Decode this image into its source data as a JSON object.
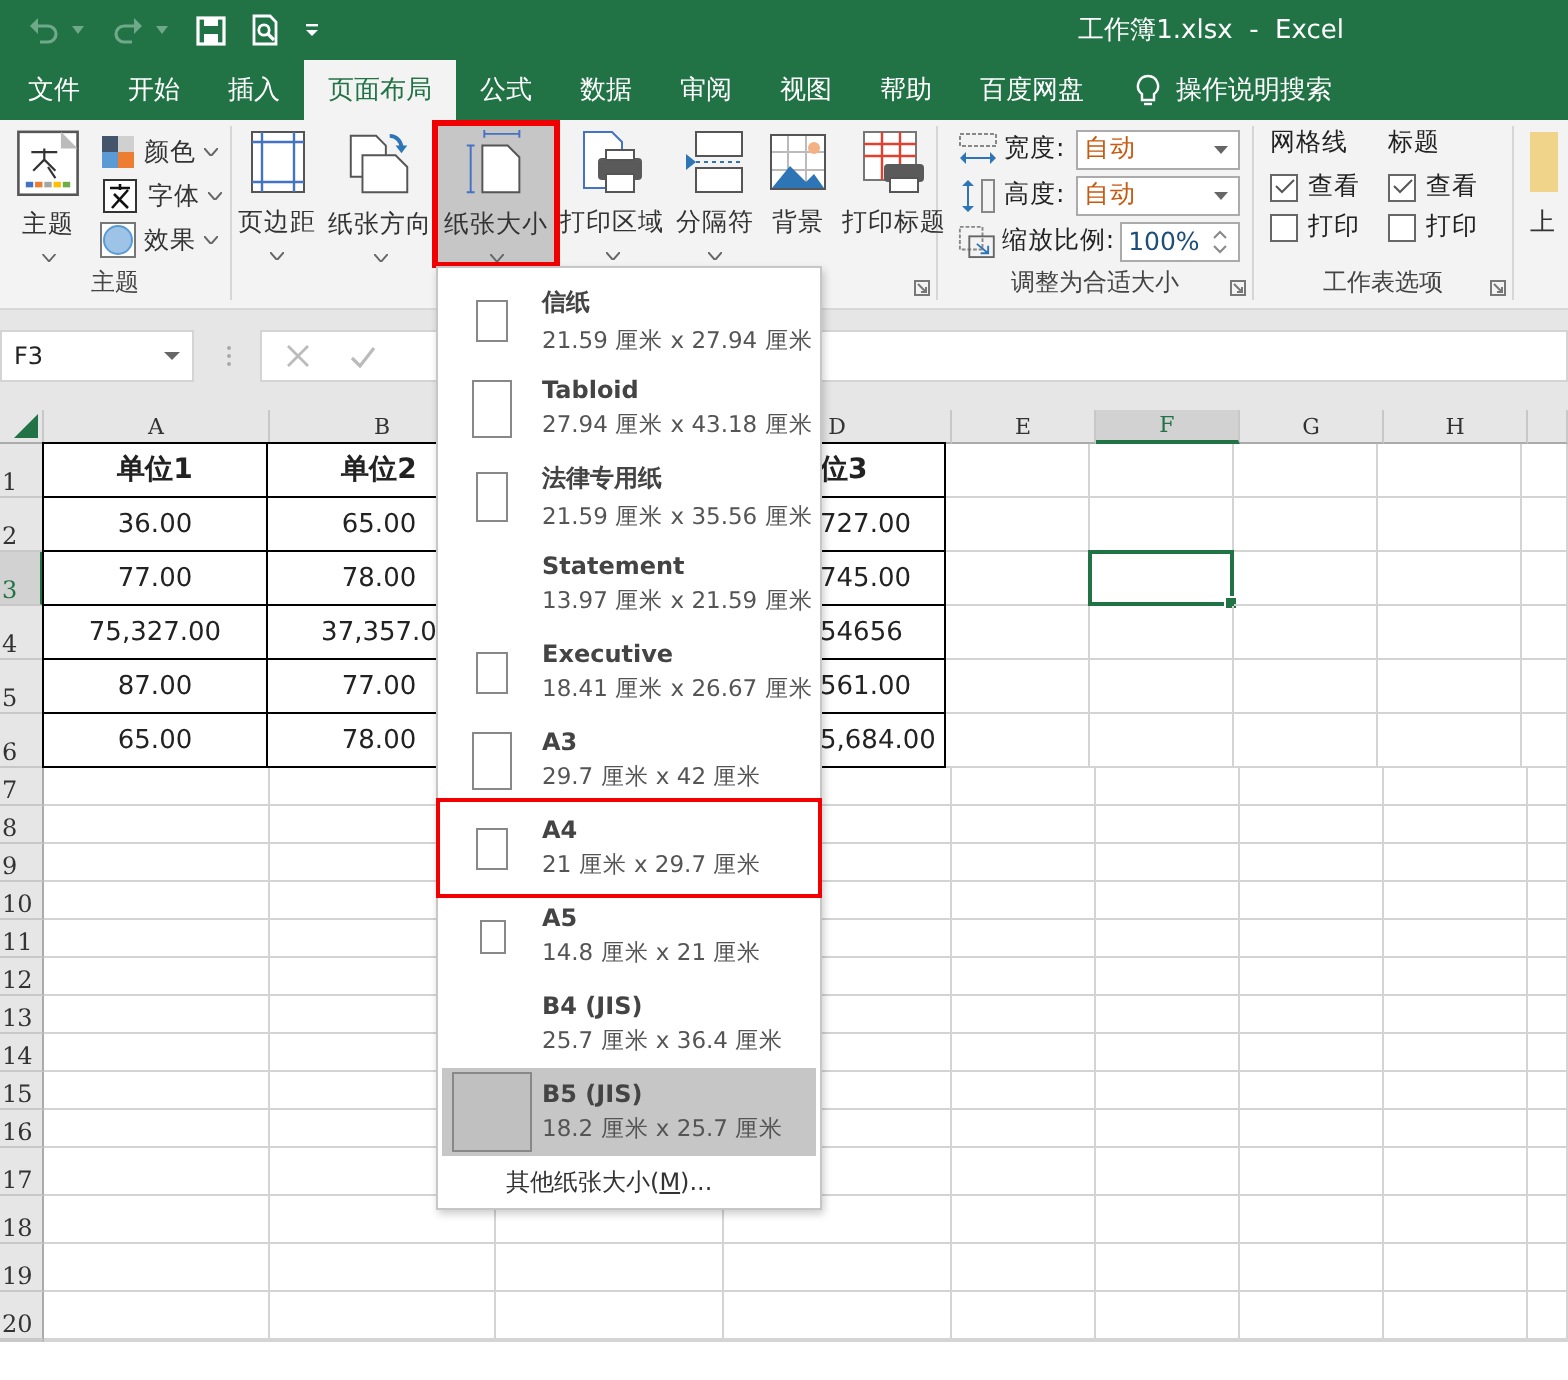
{
  "title": "工作簿1.xlsx  -  Excel",
  "tabs": [
    {
      "label": "文件",
      "selected": false
    },
    {
      "label": "开始",
      "selected": false
    },
    {
      "label": "插入",
      "selected": false
    },
    {
      "label": "页面布局",
      "selected": true
    },
    {
      "label": "公式",
      "selected": false
    },
    {
      "label": "数据",
      "selected": false
    },
    {
      "label": "审阅",
      "selected": false
    },
    {
      "label": "视图",
      "selected": false
    },
    {
      "label": "帮助",
      "selected": false
    },
    {
      "label": "百度网盘",
      "selected": false
    }
  ],
  "search": {
    "label": "操作说明搜索"
  },
  "ribbon": {
    "theme_group": {
      "label": "主题",
      "main": {
        "label": "主题"
      },
      "options": [
        {
          "label": "颜色",
          "kind": "colors"
        },
        {
          "label": "字体",
          "kind": "fonts"
        },
        {
          "label": "效果",
          "kind": "effects"
        }
      ]
    },
    "page_setup": {
      "buttons": [
        {
          "label": "页边距",
          "kind": "margins",
          "has_menu": true,
          "pressed": false,
          "highlighted": false
        },
        {
          "label": "纸张方向",
          "kind": "orientation",
          "has_menu": true,
          "pressed": false,
          "highlighted": false
        },
        {
          "label": "纸张大小",
          "kind": "size",
          "has_menu": true,
          "pressed": true,
          "highlighted": true
        },
        {
          "label": "打印区域",
          "kind": "print_area",
          "has_menu": true,
          "pressed": false,
          "highlighted": false
        },
        {
          "label": "分隔符",
          "kind": "breaks",
          "has_menu": true,
          "pressed": false,
          "highlighted": false
        },
        {
          "label": "背景",
          "kind": "background",
          "has_menu": false,
          "pressed": false,
          "highlighted": false
        },
        {
          "label": "打印标题",
          "kind": "print_titles",
          "has_menu": false,
          "pressed": false,
          "highlighted": false
        }
      ]
    },
    "scale_group": {
      "label": "调整为合适大小",
      "fields": [
        {
          "label": "宽度:",
          "kind": "width",
          "value": "自动"
        },
        {
          "label": "高度:",
          "kind": "height",
          "value": "自动"
        },
        {
          "label": "缩放比例:",
          "kind": "scale",
          "value": "100%"
        }
      ]
    },
    "sheet_options": {
      "label": "工作表选项",
      "columns": [
        {
          "heading": "网格线",
          "options": [
            {
              "label": "查看",
              "checked": true
            },
            {
              "label": "打印",
              "checked": false
            }
          ]
        },
        {
          "heading": "标题",
          "options": [
            {
              "label": "查看",
              "checked": true
            },
            {
              "label": "打印",
              "checked": false
            }
          ]
        }
      ]
    },
    "cut_off_button": {
      "label": "上"
    }
  },
  "name_box": "F3",
  "columns": [
    {
      "label": "A",
      "selected": false
    },
    {
      "label": "B",
      "selected": false
    },
    {
      "label": "D",
      "selected": false
    },
    {
      "label": "E",
      "selected": false
    },
    {
      "label": "F",
      "selected": true
    },
    {
      "label": "G",
      "selected": false
    },
    {
      "label": "H",
      "selected": false
    }
  ],
  "rows": [
    {
      "label": "1",
      "selected": false,
      "cells": [
        {
          "text": "单位1",
          "bold": true
        },
        {
          "text": "单位2",
          "bold": true
        },
        {
          "text": "位3",
          "bold": true
        }
      ]
    },
    {
      "label": "2",
      "selected": false,
      "cells": [
        {
          "text": "36.00",
          "bold": false
        },
        {
          "text": "65.00",
          "bold": false
        },
        {
          "text": "727.00",
          "bold": false
        }
      ]
    },
    {
      "label": "3",
      "selected": true,
      "cells": [
        {
          "text": "77.00",
          "bold": false
        },
        {
          "text": "78.00",
          "bold": false
        },
        {
          "text": "745.00",
          "bold": false
        },
        null,
        {
          "active": true
        }
      ]
    },
    {
      "label": "4",
      "selected": false,
      "cells": [
        {
          "text": "75,327.00",
          "bold": false
        },
        {
          "text": "37,357.0",
          "bold": false
        },
        {
          "text": "54656",
          "bold": false
        }
      ]
    },
    {
      "label": "5",
      "selected": false,
      "cells": [
        {
          "text": "87.00",
          "bold": false
        },
        {
          "text": "77.00",
          "bold": false
        },
        {
          "text": "561.00",
          "bold": false
        }
      ]
    },
    {
      "label": "6",
      "selected": false,
      "cells": [
        {
          "text": "65.00",
          "bold": false
        },
        {
          "text": "78.00",
          "bold": false
        },
        {
          "text": "5,684.00",
          "bold": false
        }
      ]
    },
    {
      "label": "7",
      "selected": false
    },
    {
      "label": "8",
      "selected": false
    },
    {
      "label": "9",
      "selected": false
    },
    {
      "label": "10",
      "selected": false
    },
    {
      "label": "11",
      "selected": false
    },
    {
      "label": "12",
      "selected": false
    },
    {
      "label": "13",
      "selected": false
    },
    {
      "label": "14",
      "selected": false
    },
    {
      "label": "15",
      "selected": false
    },
    {
      "label": "16",
      "selected": false
    },
    {
      "label": "17",
      "selected": false
    },
    {
      "label": "18",
      "selected": false
    },
    {
      "label": "19",
      "selected": false
    },
    {
      "label": "20",
      "selected": false
    }
  ],
  "paper_menu": {
    "items": [
      {
        "name": "信纸",
        "size": "21.59 厘米 x 27.94 厘米",
        "selected": false,
        "highlighted": false
      },
      {
        "name": "Tabloid",
        "size": "27.94 厘米 x 43.18 厘米",
        "selected": false,
        "highlighted": false
      },
      {
        "name": "法律专用纸",
        "size": "21.59 厘米 x 35.56 厘米",
        "selected": false,
        "highlighted": false
      },
      {
        "name": "Statement",
        "size": "13.97 厘米 x 21.59 厘米",
        "selected": false,
        "highlighted": false
      },
      {
        "name": "Executive",
        "size": "18.41 厘米 x 26.67 厘米",
        "selected": false,
        "highlighted": false
      },
      {
        "name": "A3",
        "size": "29.7 厘米 x 42 厘米",
        "selected": false,
        "highlighted": false
      },
      {
        "name": "A4",
        "size": "21 厘米 x 29.7 厘米",
        "selected": false,
        "highlighted": true
      },
      {
        "name": "A5",
        "size": "14.8 厘米 x 21 厘米",
        "selected": false,
        "highlighted": false
      },
      {
        "name": "B4 (JIS)",
        "size": "25.7 厘米 x 36.4 厘米",
        "selected": false,
        "highlighted": false
      },
      {
        "name": "B5 (JIS)",
        "size": "18.2 厘米 x 25.7 厘米",
        "selected": true,
        "highlighted": false
      }
    ],
    "more": {
      "before": "其他纸张大小(",
      "key": "M",
      "after": ")..."
    }
  }
}
